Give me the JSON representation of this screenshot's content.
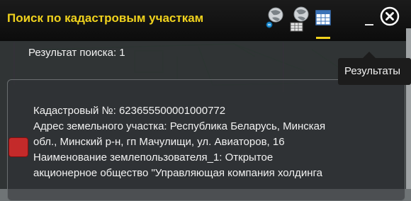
{
  "window": {
    "title": "Поиск по кадастровым участкам"
  },
  "toolbar": {
    "tools": [
      {
        "icon": "globe-query-icon"
      },
      {
        "icon": "globe-table-icon"
      },
      {
        "icon": "results-table-icon",
        "active": true
      }
    ]
  },
  "results": {
    "count_label": "Результат поиска: 1",
    "items": [
      {
        "lines": [
          "Кадастровый №: 623655500001000772",
          "Адрес земельного участка: Республика Беларусь, Минская",
          "обл., Минский р-н, гп Мачулищи, ул. Авиаторов, 16",
          "Наименование землепользователя_1: Открытое",
          "акционерное общество \"Управляющая компания холдинга"
        ]
      }
    ]
  },
  "tooltip": {
    "text": "Результаты"
  },
  "colors": {
    "accent": "#f0d21d",
    "marker": "#c42a2a",
    "titlebar": "#111111"
  }
}
